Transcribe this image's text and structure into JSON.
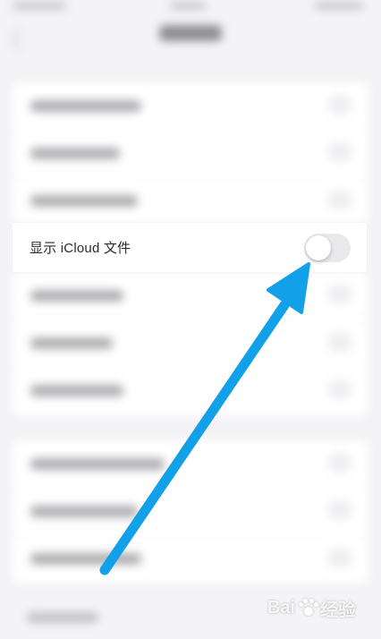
{
  "setting_row": {
    "label": "显示 iCloud 文件",
    "toggle_on": false
  },
  "colors": {
    "arrow": "#12a0e8",
    "toggle_off": "#e9e9eb",
    "background": "#f4f4f6"
  },
  "watermark": {
    "text": "Bai",
    "suffix": "经验"
  }
}
